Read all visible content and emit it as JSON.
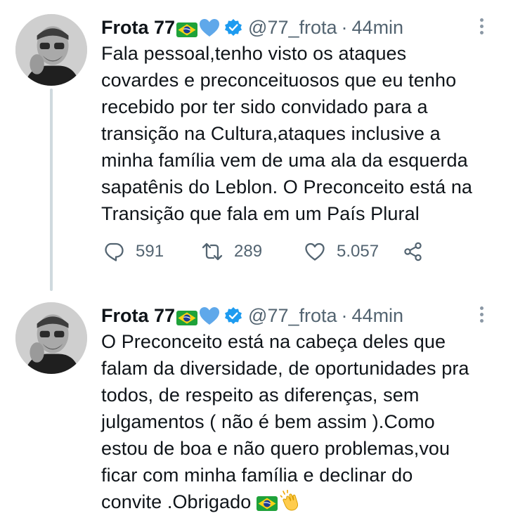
{
  "tweets": [
    {
      "author": "Frota 77",
      "handle": "@77_frota",
      "separator": "·",
      "time": "44min",
      "text": "Fala pessoal,tenho visto os ataques\ncovardes e preconceituosos que eu tenho\nrecebido por ter sido convidado para a\ntransição na Cultura,ataques inclusive a\nminha família vem de uma ala da esquerda\nsapatênis do Leblon. O Preconceito está na\nTransição que fala em um País Plural",
      "replies": "591",
      "retweets": "289",
      "likes": "5.057"
    },
    {
      "author": "Frota 77",
      "handle": "@77_frota",
      "separator": "·",
      "time": "44min",
      "text": "O Preconceito está na cabeça deles que\nfalam da diversidade, de oportunidades pra\ntodos, de respeito as diferenças, sem\njulgamentos ( não é bem assim ).Como\nestou de boa e não quero problemas,vou\nficar com minha família e declinar do\nconvite .Obrigado "
    }
  ],
  "icons": {
    "name_emojis": [
      "brazil-flag",
      "blue-heart"
    ],
    "badge": "verified-badge",
    "end_emojis": [
      "brazil-flag",
      "clapping-hands"
    ],
    "actions": [
      "reply-icon",
      "retweet-icon",
      "like-icon",
      "share-icon"
    ]
  },
  "colors": {
    "verified": "#1d9bf0",
    "heart": "#5fa8ea",
    "secondary_text": "#536471",
    "thread_line": "#cfd9de"
  }
}
